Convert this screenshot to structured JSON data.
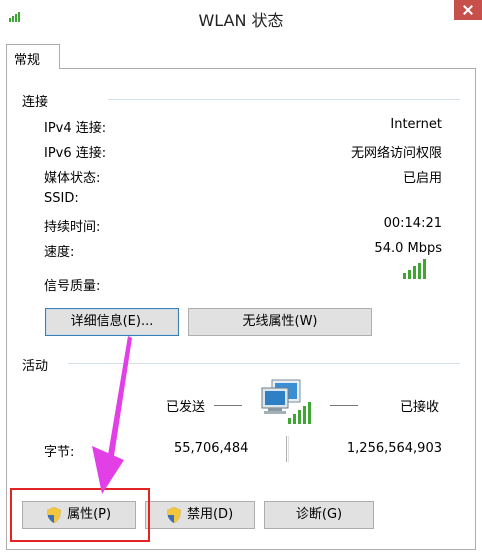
{
  "window": {
    "title": "WLAN 状态"
  },
  "tabs": [
    {
      "label": "常规"
    }
  ],
  "connection": {
    "section_title": "连接",
    "rows": [
      {
        "label": "IPv4 连接:",
        "value": "Internet"
      },
      {
        "label": "IPv6 连接:",
        "value": "无网络访问权限"
      },
      {
        "label": "媒体状态:",
        "value": "已启用"
      },
      {
        "label": "SSID:",
        "value": ""
      },
      {
        "label": "持续时间:",
        "value": "00:14:21"
      },
      {
        "label": "速度:",
        "value": "54.0 Mbps"
      }
    ],
    "signal_label": "信号质量:",
    "signal_bars": 5,
    "details_button": "详细信息(E)...",
    "wireless_props_button": "无线属性(W)"
  },
  "activity": {
    "section_title": "活动",
    "sent_label": "已发送",
    "received_label": "已接收",
    "bytes_label": "字节:",
    "bytes_sent": "55,706,484",
    "bytes_received": "1,256,564,903"
  },
  "buttons": {
    "properties": "属性(P)",
    "disable": "禁用(D)",
    "diagnose": "诊断(G)"
  },
  "colors": {
    "highlight_box": "#e32424",
    "arrow": "#e23fe6",
    "signal_green": "#3fa535"
  }
}
